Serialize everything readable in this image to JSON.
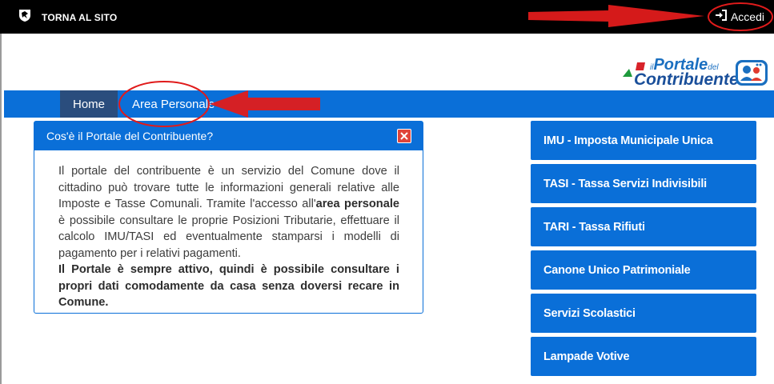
{
  "topbar": {
    "back_label": "TORNA AL SITO",
    "login_label": "Accedi"
  },
  "logo": {
    "line1_prefix": "il",
    "line1_main": "Portale",
    "line1_suffix": "del",
    "line2": "Contribuente"
  },
  "nav": {
    "home": "Home",
    "area_personale": "Area Personale"
  },
  "info_card": {
    "title": "Cos'è il Portale del Contribuente?",
    "p1_a": "Il portale del contribuente è un servizio del Comune dove il cittadino può trovare tutte le informazioni generali relative alle Imposte e Tasse Comunali. Tramite l'accesso all'",
    "p1_bold": "area personale",
    "p1_b": " è possibile consultare le proprie Posizioni Tributarie, effettuare il calcolo IMU/TASI ed eventualmente stamparsi i modelli di pagamento per i relativi pagamenti.",
    "p2": "Il Portale è sempre attivo, quindi è possibile consultare i propri dati comodamente da casa senza doversi recare in Comune."
  },
  "services": [
    "IMU - Imposta Municipale Unica",
    "TASI - Tassa Servizi Indivisibili",
    "TARI - Tassa Rifiuti",
    "Canone Unico Patrimoniale",
    "Servizi Scolastici",
    "Lampade Votive"
  ],
  "colors": {
    "primary_blue": "#0a6fd8",
    "nav_active": "#2a4d7d",
    "annotation_red": "#e01b1b"
  }
}
